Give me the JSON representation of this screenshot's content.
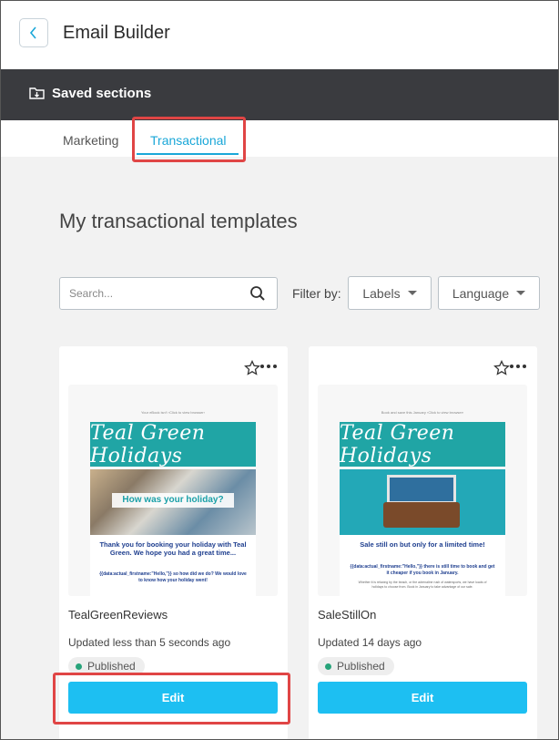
{
  "app": {
    "title": "Email Builder"
  },
  "saved_bar": {
    "label": "Saved sections"
  },
  "tabs": [
    {
      "label": "Marketing",
      "active": false
    },
    {
      "label": "Transactional",
      "active": true
    }
  ],
  "section": {
    "title": "My transactional templates"
  },
  "search": {
    "placeholder": "Search..."
  },
  "filter": {
    "label": "Filter by:",
    "labels_dropdown": "Labels",
    "language_dropdown": "Language"
  },
  "templates": [
    {
      "name": "TealGreenReviews",
      "updated": "Updated less than 5 seconds ago",
      "status": "Published",
      "edit_label": "Edit",
      "thumb": {
        "top_note": "Your eBook isn't ‹Click to view browser›",
        "brand": "Teal Green Holidays",
        "caption": "How was your holiday?",
        "headline": "Thank you for booking your holiday with Teal Green. We hope you had a great time...",
        "sub": "{{data:actual_firstname:\"Hello,\"}} so how did we do? We would love to know how your holiday went!"
      }
    },
    {
      "name": "SaleStillOn",
      "updated": "Updated 14 days ago",
      "status": "Published",
      "edit_label": "Edit",
      "thumb": {
        "top_note": "Book and save this January ‹Click to view browser›",
        "brand": "Teal Green Holidays",
        "headline": "Sale still on but only for a limited time!",
        "sub": "{{data:actual_firstname:\"Hello,\"}} there is still time to book and get it cheaper if you book in January.",
        "body": "Whether it is relaxing by the beach, or the adrenaline rush of watersports, we have loads of holidays to choose from. Book in January to take advantage of our sale."
      }
    }
  ],
  "colors": {
    "accent": "#1aa7d8",
    "edit_button": "#1dbff2",
    "header_bar": "#3a3b3f",
    "teal_brand": "#20a5a5",
    "published_dot": "#27a37a",
    "annotation_red": "#e04545"
  }
}
